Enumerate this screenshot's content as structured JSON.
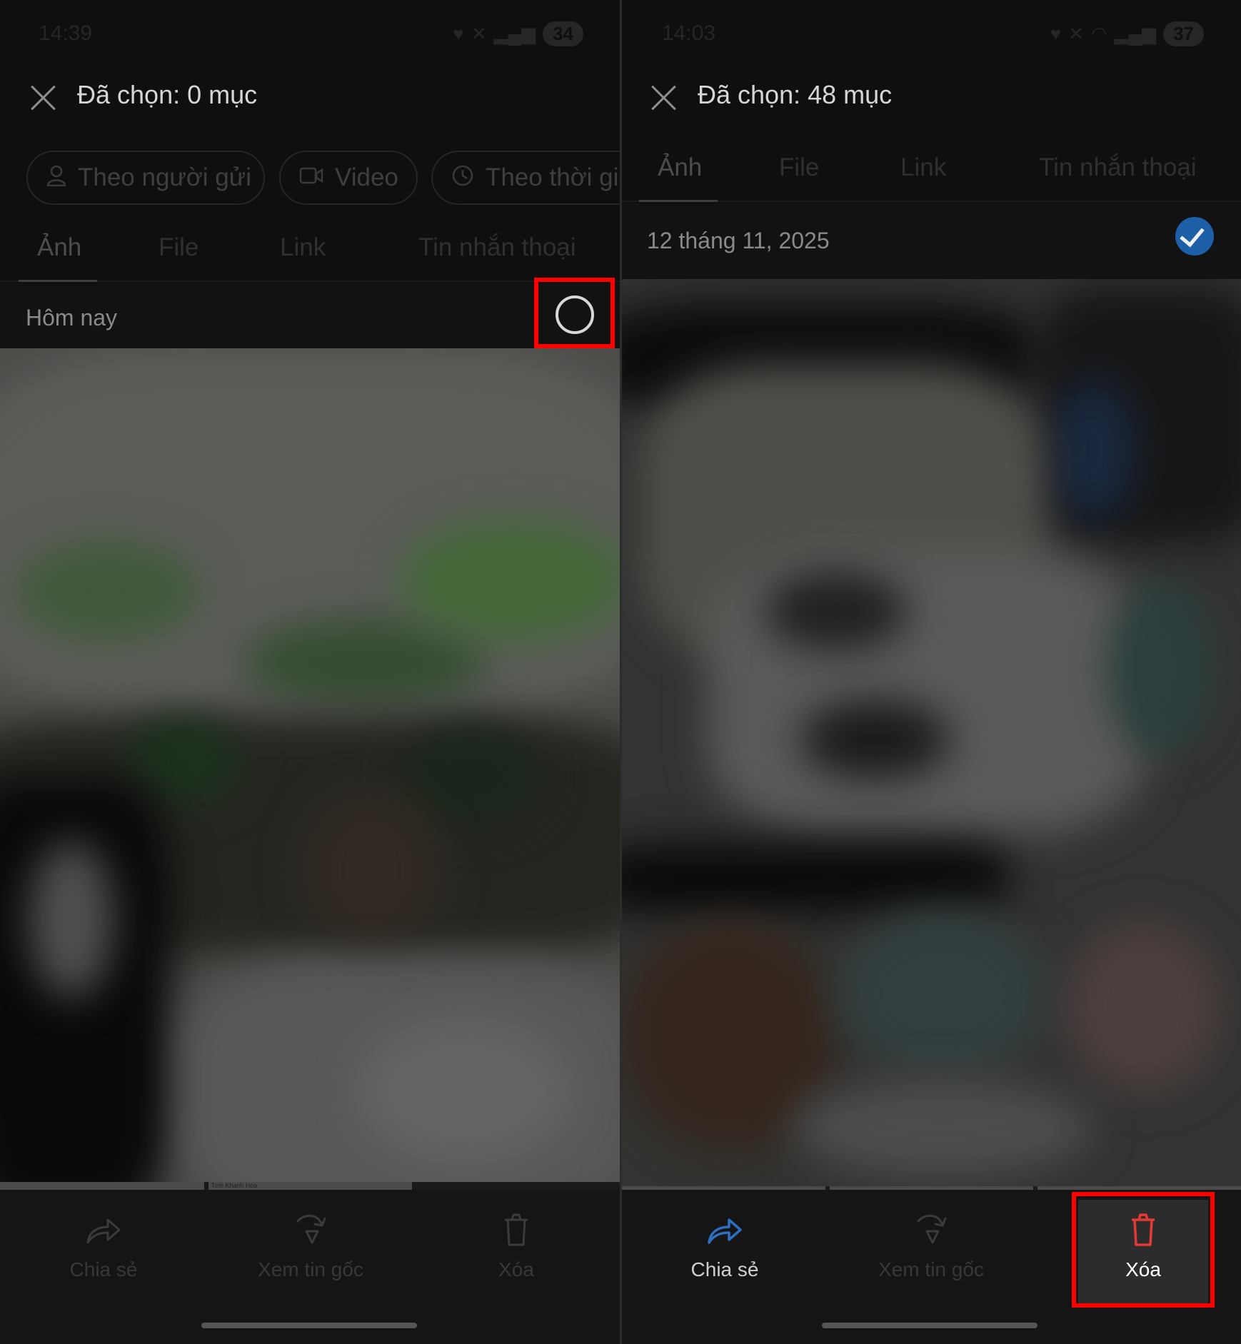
{
  "left_screen": {
    "status_time": "14:39",
    "status_battery": "34",
    "title": "Đã chọn: 0 mục",
    "chips": [
      {
        "icon": "person-icon",
        "label": "Theo người gửi"
      },
      {
        "icon": "video-icon",
        "label": "Video"
      },
      {
        "icon": "clock-icon",
        "label": "Theo thời gia"
      }
    ],
    "tabs": [
      "Ảnh",
      "File",
      "Link",
      "Tin nhắn thoại"
    ],
    "active_tab": "Ảnh",
    "section_title": "Hôm nay",
    "thumbnail_caption": "Tinh Khanh Hoa",
    "actions": {
      "share": "Chia sẻ",
      "view_original": "Xem tin gốc",
      "delete": "Xóa"
    }
  },
  "right_screen": {
    "status_time": "14:03",
    "status_battery": "37",
    "title": "Đã chọn: 48 mục",
    "tabs": [
      "Ảnh",
      "File",
      "Link",
      "Tin nhắn thoại"
    ],
    "active_tab": "Ảnh",
    "section_title": "12 tháng 11, 2025",
    "actions": {
      "share": "Chia sẻ",
      "view_original": "Xem tin gốc",
      "delete": "Xóa"
    }
  },
  "colors": {
    "highlight": "#ff0000",
    "selected_check": "#1d60a8",
    "share_icon_active": "#2f6fc2",
    "delete_icon_active": "#e53935"
  }
}
